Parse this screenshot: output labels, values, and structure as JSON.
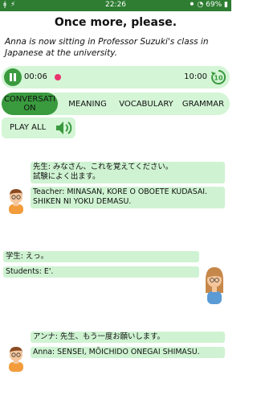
{
  "status_bar": {
    "left_icons": "ǂ ⚡",
    "time": "22:26",
    "right": "⚫ ◔ 69% ▮"
  },
  "header": {
    "title": "Once more, please.",
    "subtitle": "Anna is now sitting in Professor Suzuki's class in Japanese at the university."
  },
  "player": {
    "current_time": "00:06",
    "total_time": "10:00",
    "progress_fraction": 0.01,
    "play_state": "pause-icon",
    "replay_icon": "replay-10-icon"
  },
  "tabs": [
    {
      "label_line1": "CONVERSATI",
      "label_line2": "ON",
      "active": true
    },
    {
      "label": "MEANING",
      "active": false
    },
    {
      "label": "VOCABULARY",
      "active": false
    },
    {
      "label": "GRAMMAR",
      "active": false
    }
  ],
  "play_all": {
    "label": "PLAY ALL",
    "icon": "speaker-icon"
  },
  "dialogue": [
    {
      "speaker_side": "left",
      "avatar": "male-avatar",
      "jp_line1": "先生: みなさん、これを覚えてください。",
      "jp_line2": "試験によく出ます。",
      "romaji_line1": "Teacher: MINASAN, KORE O OBOETE KUDASAI.",
      "romaji_line2": "SHIKEN NI YOKU DEMASU."
    },
    {
      "speaker_side": "right",
      "avatar": "female-avatar",
      "jp_line1": "学生: えっ。",
      "romaji_line1": "Students: E'."
    },
    {
      "speaker_side": "left",
      "avatar": "male-avatar",
      "jp_line1": "アンナ: 先生、もう一度お願いします。",
      "romaji_line1": "Anna: SENSEI, MŌICHIDO ONEGAI SHIMASU."
    }
  ],
  "colors": {
    "status_bar": "#2e7d32",
    "accent": "#3a9a3e",
    "light_green": "#d4f5d6",
    "bubble": "#cff3d2",
    "progress_dot": "#e8336d"
  }
}
